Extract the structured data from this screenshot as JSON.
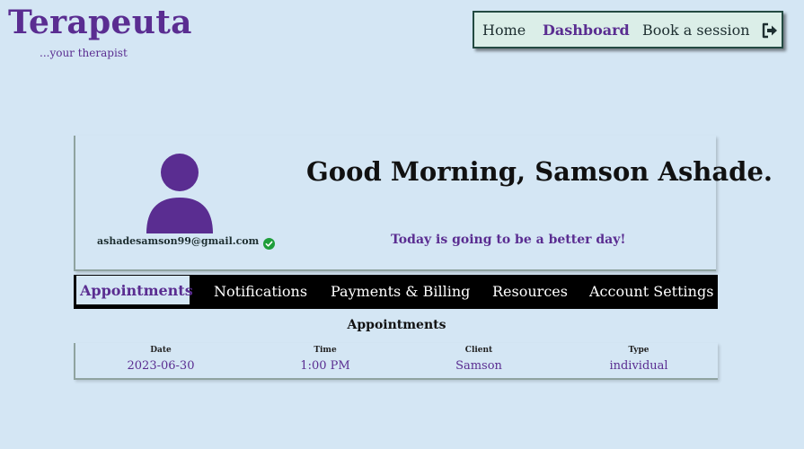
{
  "brand": {
    "title": "Terapeuta",
    "tagline": "...your therapist"
  },
  "nav": {
    "items": [
      {
        "label": "Home"
      },
      {
        "label": "Dashboard"
      },
      {
        "label": "Book a session"
      }
    ],
    "active": "Dashboard",
    "logout_icon": "sign-out-icon"
  },
  "profile": {
    "avatar_icon": "user-silhouette-icon",
    "email": "ashadesamson99@gmail.com",
    "verified_icon": "check-circle-icon",
    "greeting": "Good Morning, Samson Ashade.",
    "motto": "Today is going to be a better day!"
  },
  "tabs": {
    "items": [
      {
        "label": "Appointments"
      },
      {
        "label": "Notifications"
      },
      {
        "label": "Payments & Billing"
      },
      {
        "label": "Resources"
      },
      {
        "label": "Account Settings"
      }
    ],
    "active": "Appointments"
  },
  "appointments": {
    "heading": "Appointments",
    "columns": [
      "Date",
      "Time",
      "Client",
      "Type"
    ],
    "rows": [
      [
        "2023-06-30",
        "1:00 PM",
        "Samson",
        "individual"
      ]
    ]
  },
  "colors": {
    "background": "#d4e6f4",
    "brand": "#5a2d91",
    "nav_background": "#dbeee8",
    "tab_bar": "#000000",
    "verified": "#1e9e3a"
  }
}
